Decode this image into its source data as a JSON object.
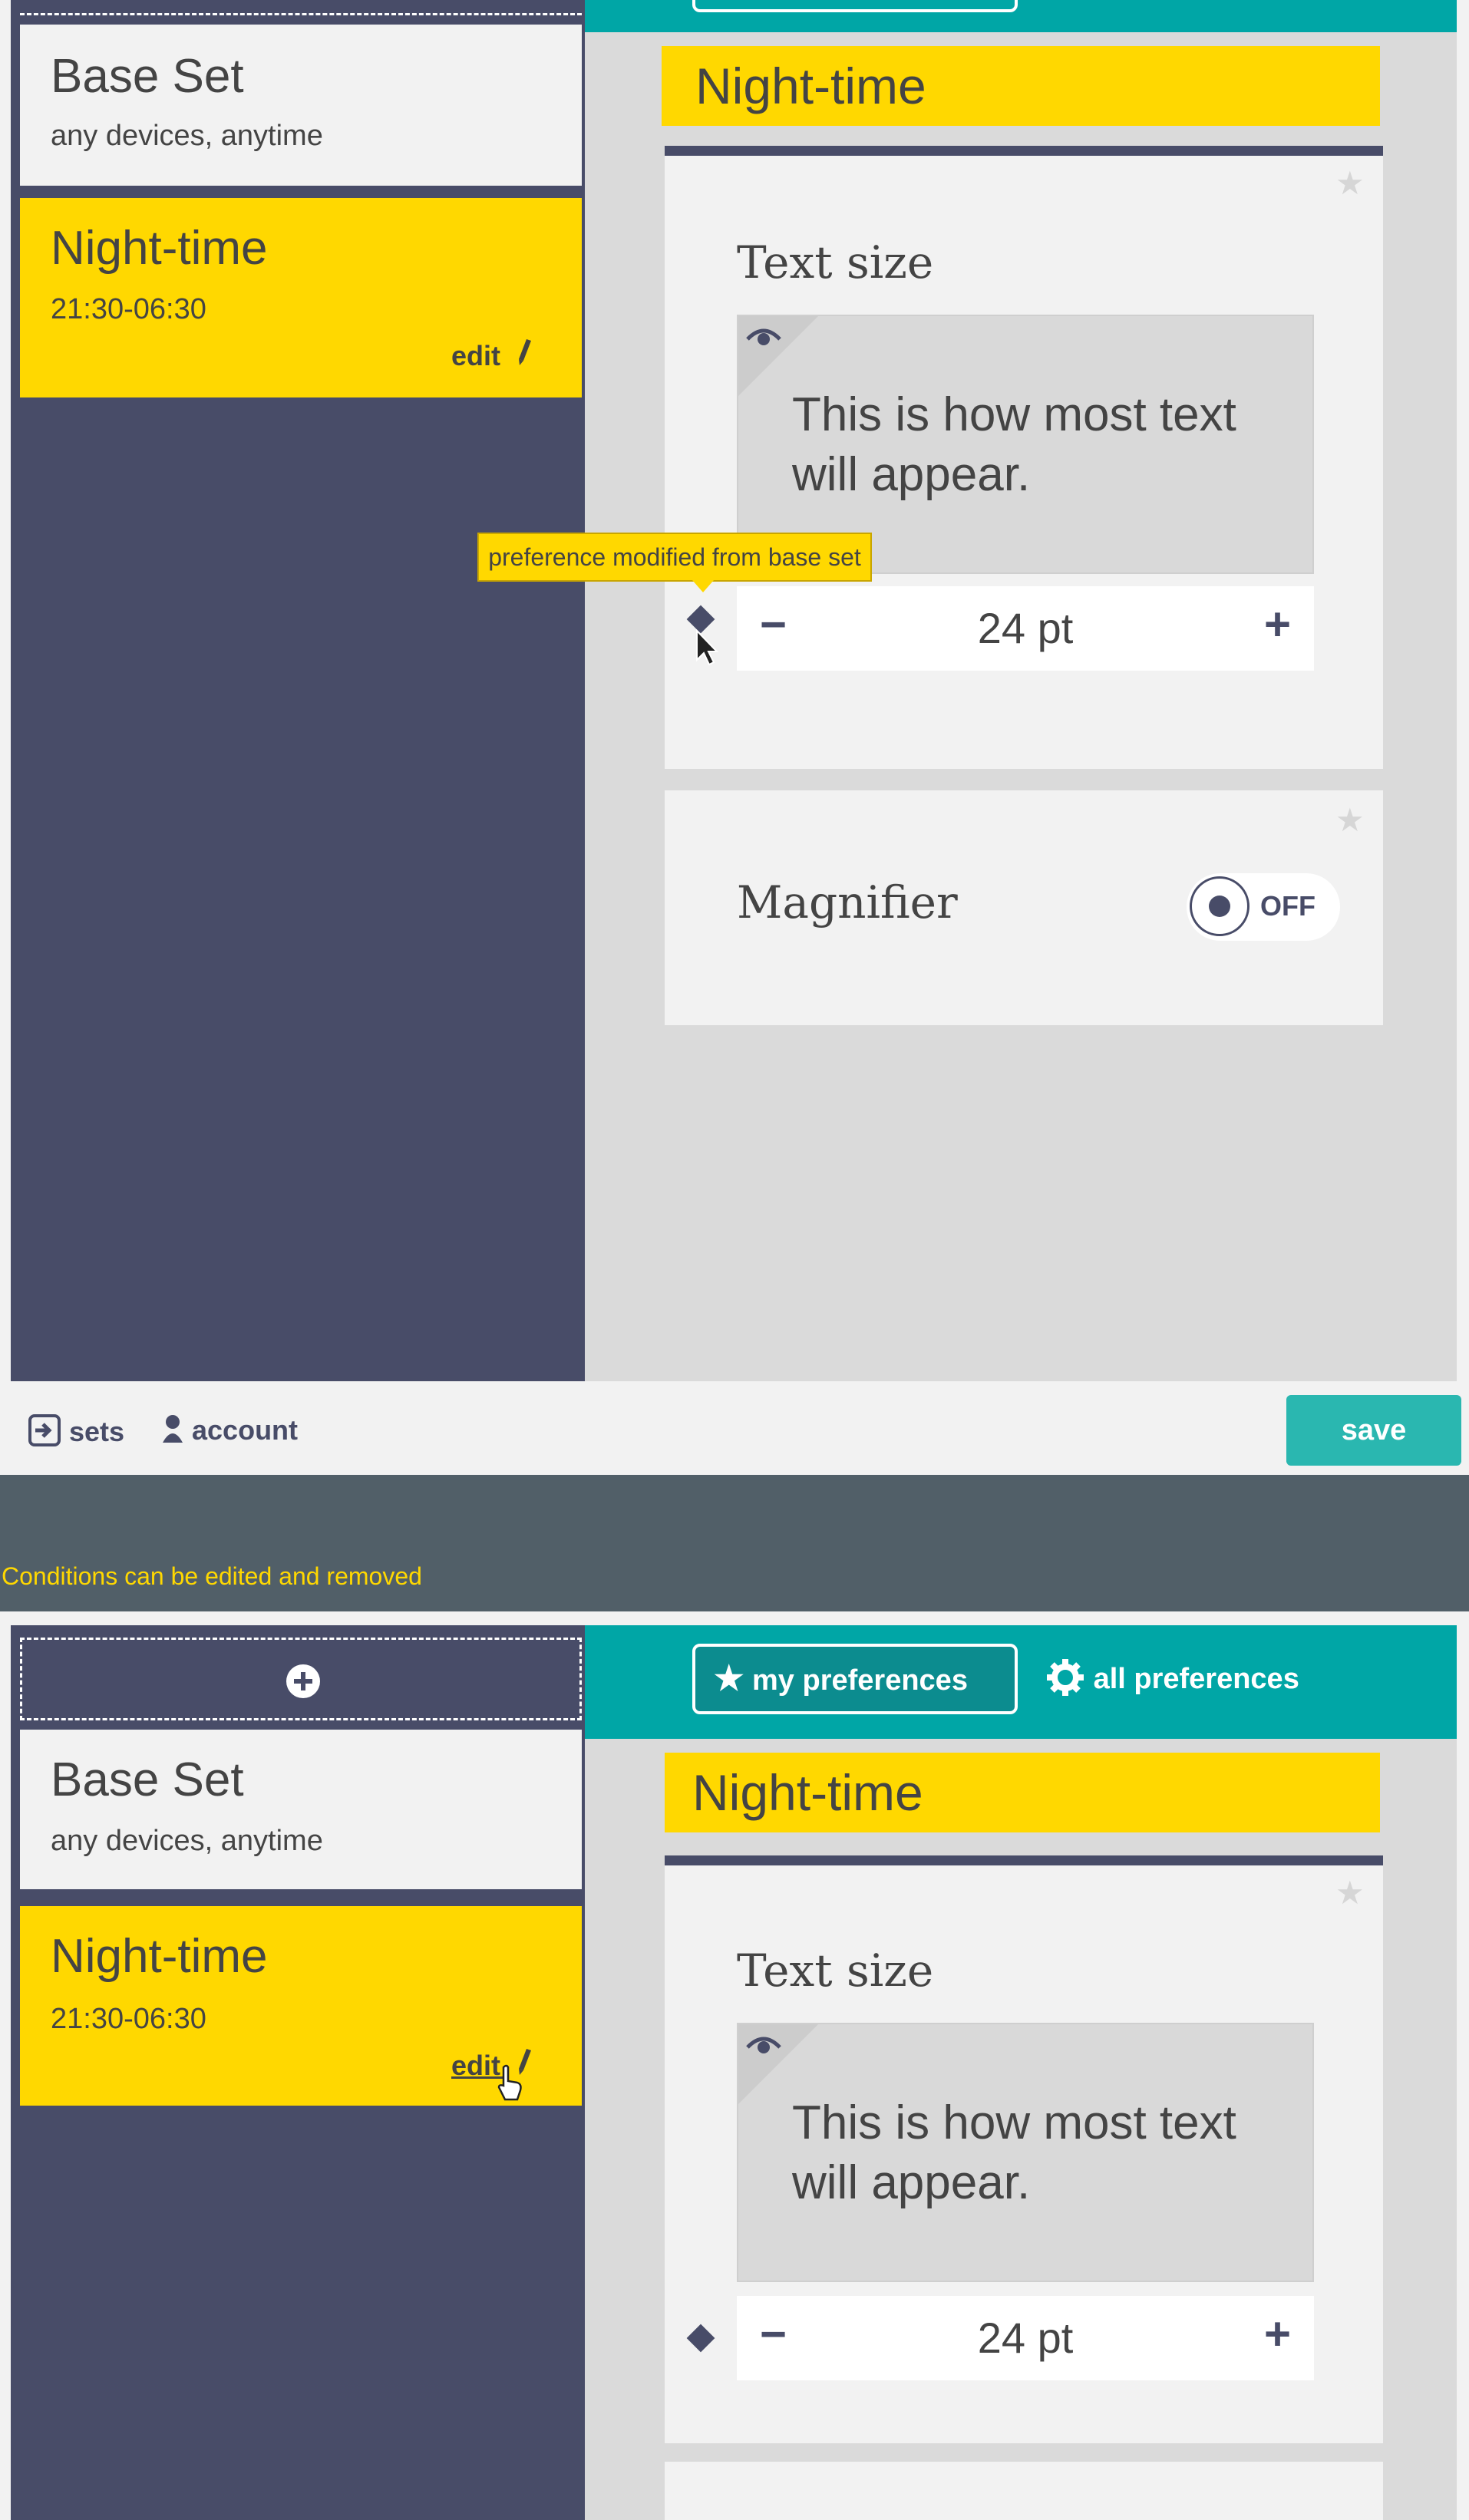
{
  "screen1": {
    "sets": [
      {
        "title": "Base Set",
        "subtitle": "any devices, anytime"
      },
      {
        "title": "Night-time",
        "subtitle": "21:30-06:30",
        "edit": "edit"
      }
    ],
    "banner": "Night-time",
    "text_size": {
      "title": "Text size",
      "preview": "This is how most text will appear.",
      "value": "24 pt",
      "tooltip": "preference modified from base set"
    },
    "magnifier": {
      "title": "Magnifier",
      "state": "OFF"
    },
    "footer": {
      "sets": "sets",
      "account": "account",
      "save": "save"
    }
  },
  "caption": "Conditions can be edited and removed",
  "screen2": {
    "tabs": [
      {
        "label": "my preferences",
        "icon": "star-icon",
        "selected": true
      },
      {
        "label": "all preferences",
        "icon": "gear-icon",
        "selected": false
      }
    ],
    "sets": [
      {
        "title": "Base Set",
        "subtitle": "any devices, anytime"
      },
      {
        "title": "Night-time",
        "subtitle": "21:30-06:30",
        "edit": "edit"
      }
    ],
    "banner": "Night-time",
    "text_size": {
      "title": "Text size",
      "preview": "This is how most text will appear.",
      "value": "24 pt"
    }
  },
  "colors": {
    "sidebar": "#484c68",
    "accent_yellow": "#ffd800",
    "teal": "#00a6a6",
    "save_button": "#2ab7b0",
    "background": "#515f68"
  }
}
